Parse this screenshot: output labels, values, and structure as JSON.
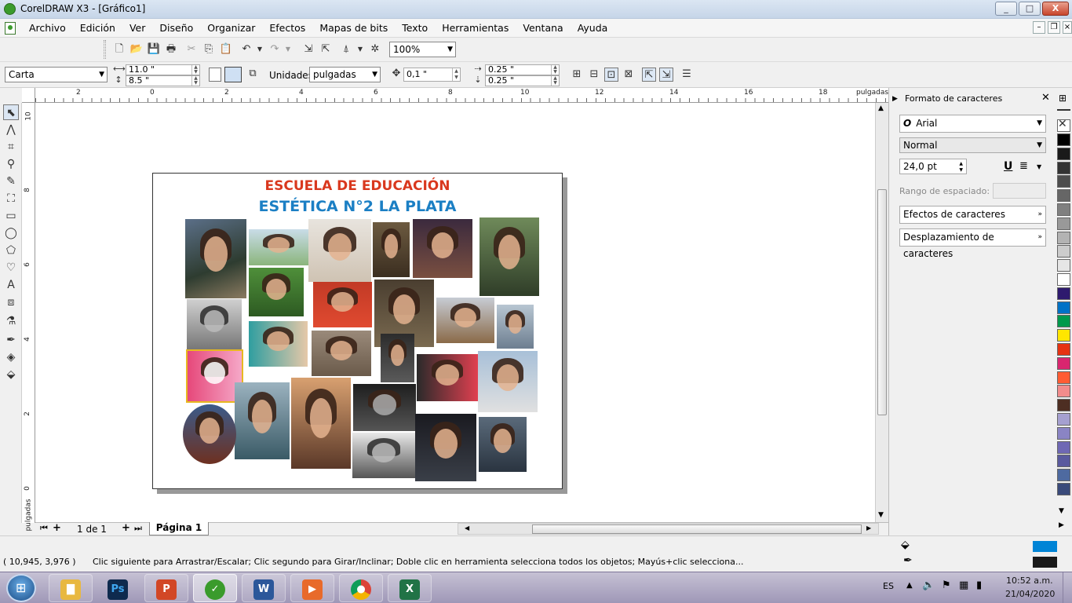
{
  "window": {
    "title": "CorelDRAW X3 - [Gráfico1]",
    "min": "_",
    "max": "□",
    "close": "X"
  },
  "menu": [
    "Archivo",
    "Edición",
    "Ver",
    "Diseño",
    "Organizar",
    "Efectos",
    "Mapas de bits",
    "Texto",
    "Herramientas",
    "Ventana",
    "Ayuda"
  ],
  "toolbar": {
    "zoom": "100%"
  },
  "propbar": {
    "paper": "Carta",
    "width": "11.0 \"",
    "height": "8.5 \"",
    "units_label": "Unidades:",
    "units": "pulgadas",
    "nudge": "0,1 \"",
    "dup_x": "0.25 \"",
    "dup_y": "0.25 \""
  },
  "rulers": {
    "h_ticks": [
      "2",
      "0",
      "2",
      "4",
      "6",
      "8",
      "10",
      "12",
      "14",
      "16",
      "18"
    ],
    "unit": "pulgadas",
    "v_ticks": [
      "10",
      "8",
      "6",
      "4",
      "2",
      "0"
    ]
  },
  "document": {
    "heading1": "ESCUELA DE EDUCACIÓN",
    "heading2": "ESTÉTICA N°2  LA PLATA",
    "heading1_color": "#d9381e",
    "heading2_color": "#1b7fc4"
  },
  "pages": {
    "counter": "1 de 1",
    "tab": "Página 1"
  },
  "docker": {
    "title": "Formato de caracteres",
    "font": "Arial",
    "style": "Normal",
    "size": "24,0 pt",
    "spacing_label": "Rango de espaciado:",
    "effects": "Efectos de caracteres",
    "shift": "Desplazamiento de caracteres"
  },
  "palette": [
    "#ffffff",
    "#000000",
    "#1a1a1a",
    "#333333",
    "#4d4d4d",
    "#666666",
    "#808080",
    "#999999",
    "#b3b3b3",
    "#cccccc",
    "#e6e6e6",
    "#ffffff",
    "#2e1a6e",
    "#0072c6",
    "#00994c",
    "#ffe600",
    "#e63312",
    "#d9266f",
    "#ff5c33",
    "#f28c8c",
    "#4d2e22",
    "#a5a0d0",
    "#8a84c4",
    "#6f68b4",
    "#5a5a9e",
    "#4e6aa0",
    "#3a4a7a"
  ],
  "status": {
    "coords": "( 10,945, 3,976 )",
    "hint": "Clic siguiente para Arrastrar/Escalar; Clic segundo para Girar/Inclinar; Doble clic en herramienta selecciona todos los objetos; Mayús+clic selecciona...",
    "fill_color": "#0084d6",
    "outline_color": "#1a1a1a"
  },
  "taskbar": {
    "apps": [
      "Explorador",
      "Photoshop",
      "PowerPoint",
      "CorelDRAW",
      "Word",
      "Reproductor",
      "Chrome",
      "Excel"
    ],
    "lang": "ES",
    "time": "10:52 a.m.",
    "date": "21/04/2020"
  }
}
